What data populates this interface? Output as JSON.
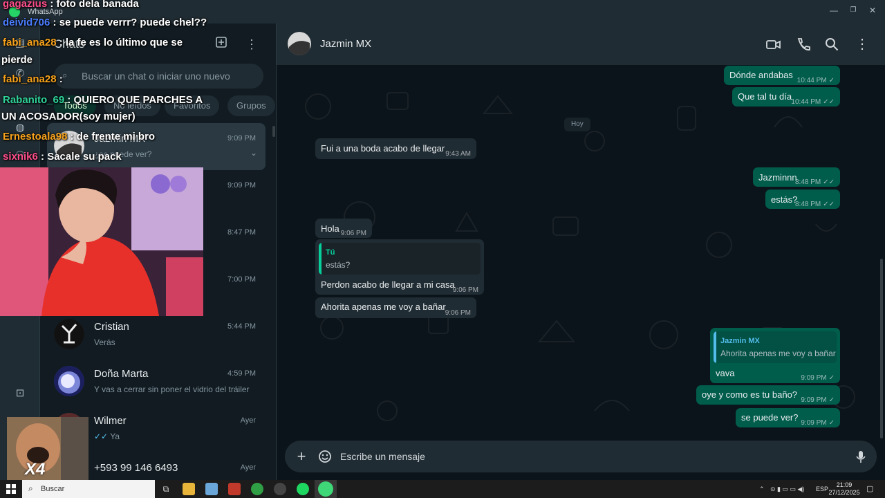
{
  "window": {
    "app_name": "WhatsApp",
    "min_icon": "minimize-icon",
    "max_icon": "maximize-icon",
    "close_icon": "close-icon"
  },
  "rail": {
    "icons": [
      "chats-icon",
      "calls-icon",
      "status-icon",
      "channels-icon",
      "communities-icon",
      "meta-ai-icon"
    ]
  },
  "sidebar": {
    "title": "Chats",
    "new_chat_icon": "new-chat-icon",
    "menu_icon": "menu-icon",
    "search_placeholder": "Buscar un chat o iniciar uno nuevo",
    "filters": [
      "Todos",
      "No leídos",
      "Favoritos",
      "Grupos"
    ],
    "active_filter": "Todos",
    "chats": [
      {
        "name": "Jazmin MX",
        "preview": "¿se puede ver?",
        "time": "9:09 PM",
        "selected": true
      },
      {
        "name": "",
        "preview": "",
        "time": "9:09 PM"
      },
      {
        "name": "",
        "preview": "",
        "time": "8:47 PM"
      },
      {
        "name": "",
        "preview": "",
        "time": "7:00 PM"
      },
      {
        "name": "Cristian",
        "preview": "Verás",
        "time": "5:44 PM"
      },
      {
        "name": "Doña Marta",
        "preview": "Y vas a cerrar sin poner el vidrio del tráiler",
        "time": "4:59 PM"
      },
      {
        "name": "Wilmer",
        "preview": "Ya",
        "preview_ticks": "✓✓",
        "time": "Ayer"
      },
      {
        "name": "+593 99 146 6493",
        "preview": "",
        "time": "Ayer"
      }
    ]
  },
  "conversation": {
    "contact_name": "Jazmin MX",
    "header_icons": [
      "video-call-icon",
      "voice-call-icon",
      "search-icon",
      "menu-icon"
    ],
    "day_label": "Hoy",
    "messages": [
      {
        "dir": "out",
        "text": "Dónde andabas",
        "time": "10:44 PM",
        "ticks": "✓"
      },
      {
        "dir": "out",
        "text": "Que tal tu día",
        "time": "10:44 PM",
        "ticks": "✓✓"
      },
      {
        "dir": "in",
        "text": "Fui a una boda acabo de llegar",
        "time": "9:43 AM"
      },
      {
        "dir": "out",
        "text": "Jazminnn",
        "time": "8:48 PM",
        "ticks": "✓✓"
      },
      {
        "dir": "out",
        "text": "estás?",
        "time": "8:48 PM",
        "ticks": "✓✓"
      },
      {
        "dir": "in",
        "text": "Hola",
        "time": "9:06 PM"
      },
      {
        "dir": "in",
        "text": "Perdon acabo de llegar a mi casa",
        "time": "9:06 PM",
        "quote_name": "Tú",
        "quote_text": "estás?"
      },
      {
        "dir": "in",
        "text": "Ahorita apenas me voy a bañar",
        "time": "9:06 PM"
      },
      {
        "dir": "out",
        "text": "vava",
        "time": "9:09 PM",
        "ticks": "✓",
        "quote_name": "Jazmin MX",
        "quote_text": "Ahorita apenas me voy a bañar"
      },
      {
        "dir": "out",
        "text": "oye y como es tu baño?",
        "time": "9:09 PM",
        "ticks": "✓"
      },
      {
        "dir": "out",
        "text": "se puede ver?",
        "time": "9:09 PM",
        "ticks": "✓"
      }
    ],
    "composer_placeholder": "Escribe un mensaje",
    "attach_icon": "plus-icon",
    "sticker_icon": "sticker-icon",
    "mic_icon": "mic-icon"
  },
  "taskbar": {
    "search_label": "Buscar",
    "lang": "ESP",
    "time": "21:09",
    "date": "27/12/2025",
    "apps": [
      "task-view-icon",
      "file-explorer-icon",
      "notes-app-icon",
      "app-icon",
      "chrome-icon",
      "app-icon-2",
      "spotify-icon",
      "whatsapp-icon"
    ]
  },
  "stream_chat": [
    {
      "user": "gagazius",
      "msg": " : foto dela banada",
      "color": "#ff4f8b"
    },
    {
      "user": "deivid706",
      "msg": " : se puede verrr? puede chel??",
      "color": "#4a7dff"
    },
    {
      "user": "fabi_ana28",
      "msg": " : la fe es lo último que se",
      "color": "#f7a21b"
    },
    {
      "user": "",
      "msg": "pierde",
      "color": "#ffffff"
    },
    {
      "user": "fabi_ana28",
      "msg": " :",
      "color": "#f7a21b"
    },
    {
      "user": "Rabanito_69",
      "msg": " : QUIERO QUE PARCHES A",
      "color": "#2fd39a"
    },
    {
      "user": "",
      "msg": "UN ACOSADOR(soy mujer)",
      "color": "#ffffff"
    },
    {
      "user": "Ernestoala98",
      "msg": " : de frente mi bro",
      "color": "#f7a21b"
    },
    {
      "user": "sixnik6",
      "msg": " : Sacale su pack",
      "color": "#ff4f8b"
    }
  ],
  "small_cam_text": "X4"
}
